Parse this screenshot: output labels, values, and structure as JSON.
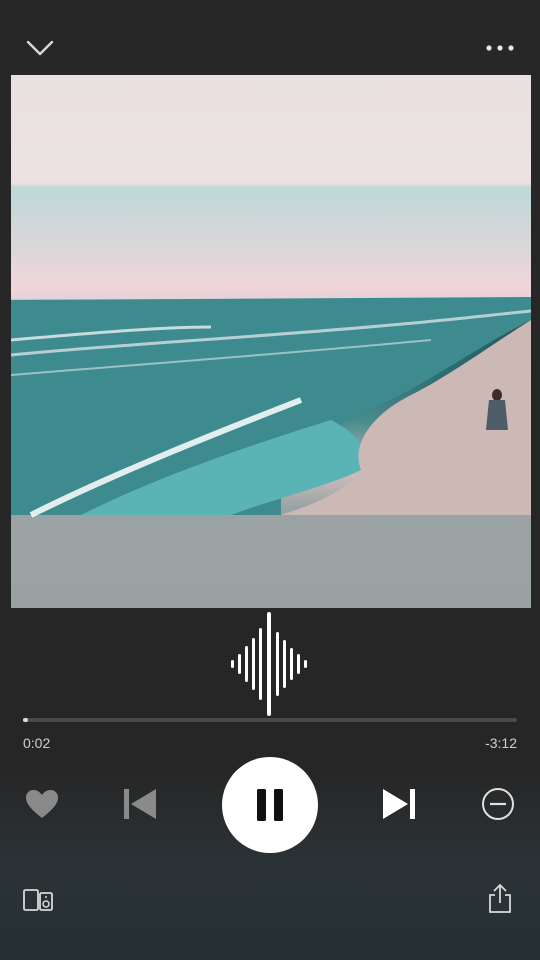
{
  "header": {
    "collapse_icon": "chevron-down-icon",
    "more_icon": "more-horizontal-icon"
  },
  "artwork": {
    "image": "album-art-beach-shoreline"
  },
  "visualizer": {
    "icon": "audio-waveform-icon"
  },
  "playback": {
    "elapsed": "0:02",
    "remaining": "-3:12",
    "progress_fraction": 0.01
  },
  "controls": {
    "heart_icon": "heart-icon",
    "previous_icon": "skip-previous-icon",
    "pause_icon": "pause-icon",
    "next_icon": "skip-next-icon",
    "remove_icon": "minus-circle-icon"
  },
  "footer": {
    "devices_icon": "devices-icon",
    "share_icon": "share-icon"
  },
  "colors": {
    "background": "#272727",
    "accent": "#ffffff",
    "muted": "#8a8a8a"
  }
}
